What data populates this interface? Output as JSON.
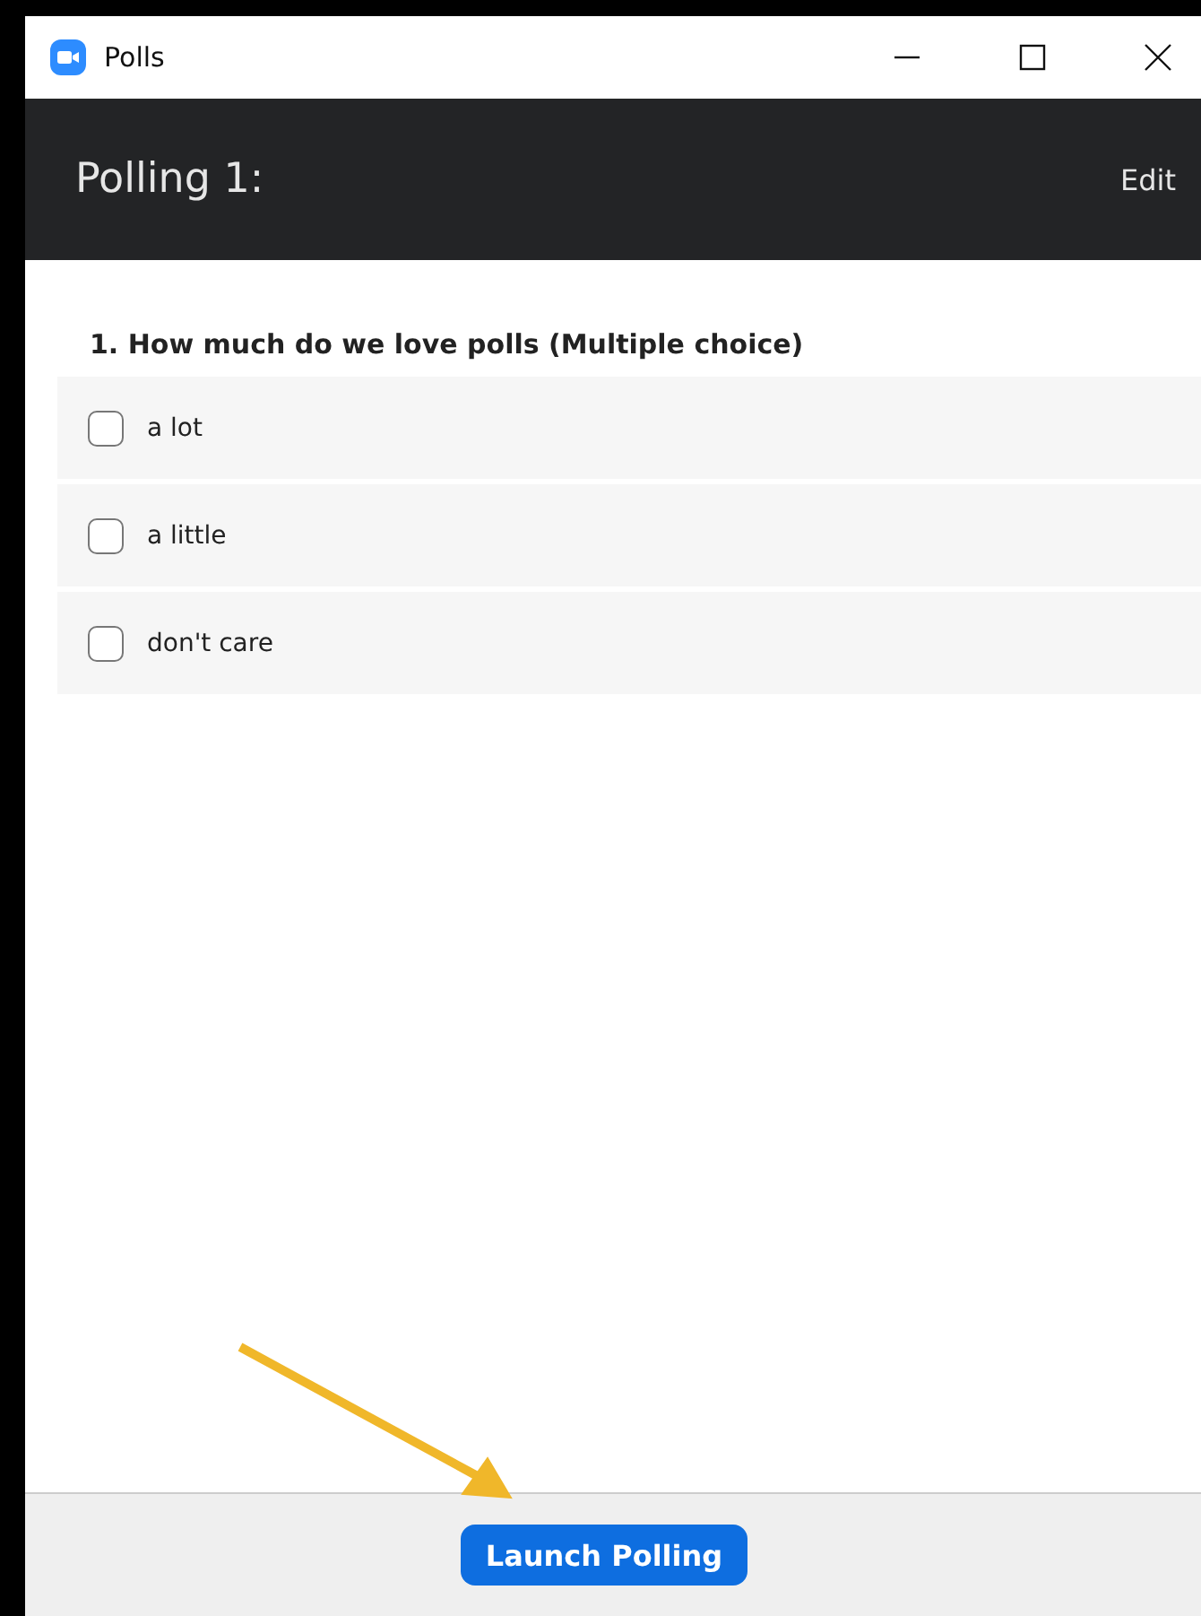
{
  "window": {
    "title": "Polls"
  },
  "header": {
    "title": "Polling 1:",
    "action": "Edit"
  },
  "question": {
    "text": "1. How much do we love polls (Multiple choice)",
    "options": [
      {
        "label": "a lot",
        "checked": false
      },
      {
        "label": "a little",
        "checked": false
      },
      {
        "label": "don't care",
        "checked": false
      }
    ]
  },
  "footer": {
    "button": "Launch Polling"
  }
}
